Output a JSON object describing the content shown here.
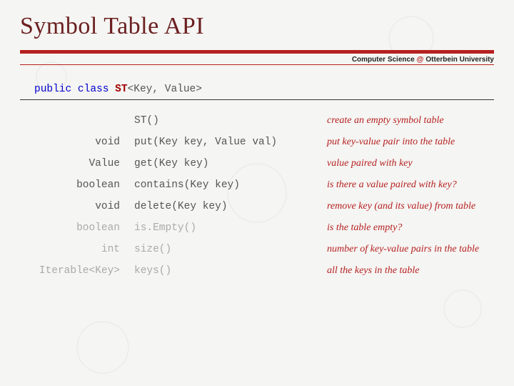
{
  "title": "Symbol Table API",
  "subheader": {
    "left": "Computer Science",
    "at": "@",
    "right": "Otterbein University"
  },
  "class_decl": {
    "public": "public",
    "class": "class",
    "name": "ST",
    "generic": "<Key, Value>"
  },
  "rows": [
    {
      "ret": "",
      "sig": "ST()",
      "desc": "create an empty symbol table",
      "dim": false
    },
    {
      "ret": "void",
      "sig": "put(Key key, Value val)",
      "desc": "put key-value pair into the table",
      "dim": false
    },
    {
      "ret": "Value",
      "sig": "get(Key key)",
      "desc": "value paired with key",
      "dim": false
    },
    {
      "ret": "boolean",
      "sig": "contains(Key key)",
      "desc": "is there a value paired with key?",
      "dim": false
    },
    {
      "ret": "void",
      "sig": "delete(Key key)",
      "desc": "remove key (and its value) from table",
      "dim": false
    },
    {
      "ret": "boolean",
      "sig": "is.Empty()",
      "desc": "is the table empty?",
      "dim": true
    },
    {
      "ret": "int",
      "sig": "size()",
      "desc": "number of key-value pairs in the table",
      "dim": true
    },
    {
      "ret": "Iterable<Key>",
      "sig": "keys()",
      "desc": "all the keys in the table",
      "dim": true
    }
  ]
}
